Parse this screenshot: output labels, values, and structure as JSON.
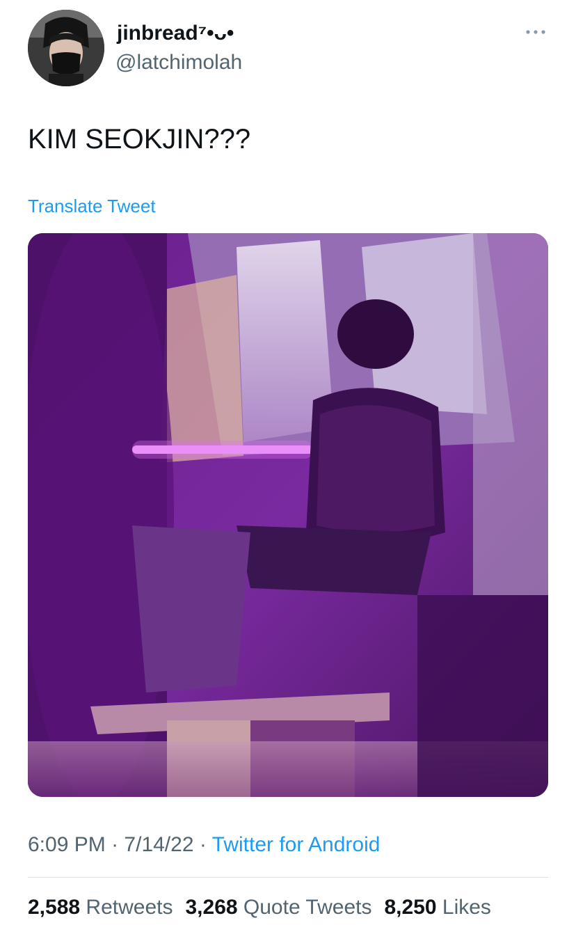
{
  "author": {
    "display_name": "jinbread⁷•ᴗ•",
    "handle": "@latchimolah"
  },
  "tweet": {
    "text": "KIM SEOKJIN???",
    "translate_label": "Translate Tweet"
  },
  "meta": {
    "time": "6:09 PM",
    "separator": "·",
    "date": "7/14/22",
    "source": "Twitter for Android"
  },
  "stats": {
    "retweets_count": "2,588",
    "retweets_label": "Retweets",
    "quotes_count": "3,268",
    "quotes_label": "Quote Tweets",
    "likes_count": "8,250",
    "likes_label": "Likes"
  },
  "icons": {
    "more": "more-horizontal-icon"
  },
  "colors": {
    "link": "#1d9bf0",
    "secondary_text": "#536471",
    "primary_text": "#0f1419",
    "divider": "#d9dfe3"
  }
}
